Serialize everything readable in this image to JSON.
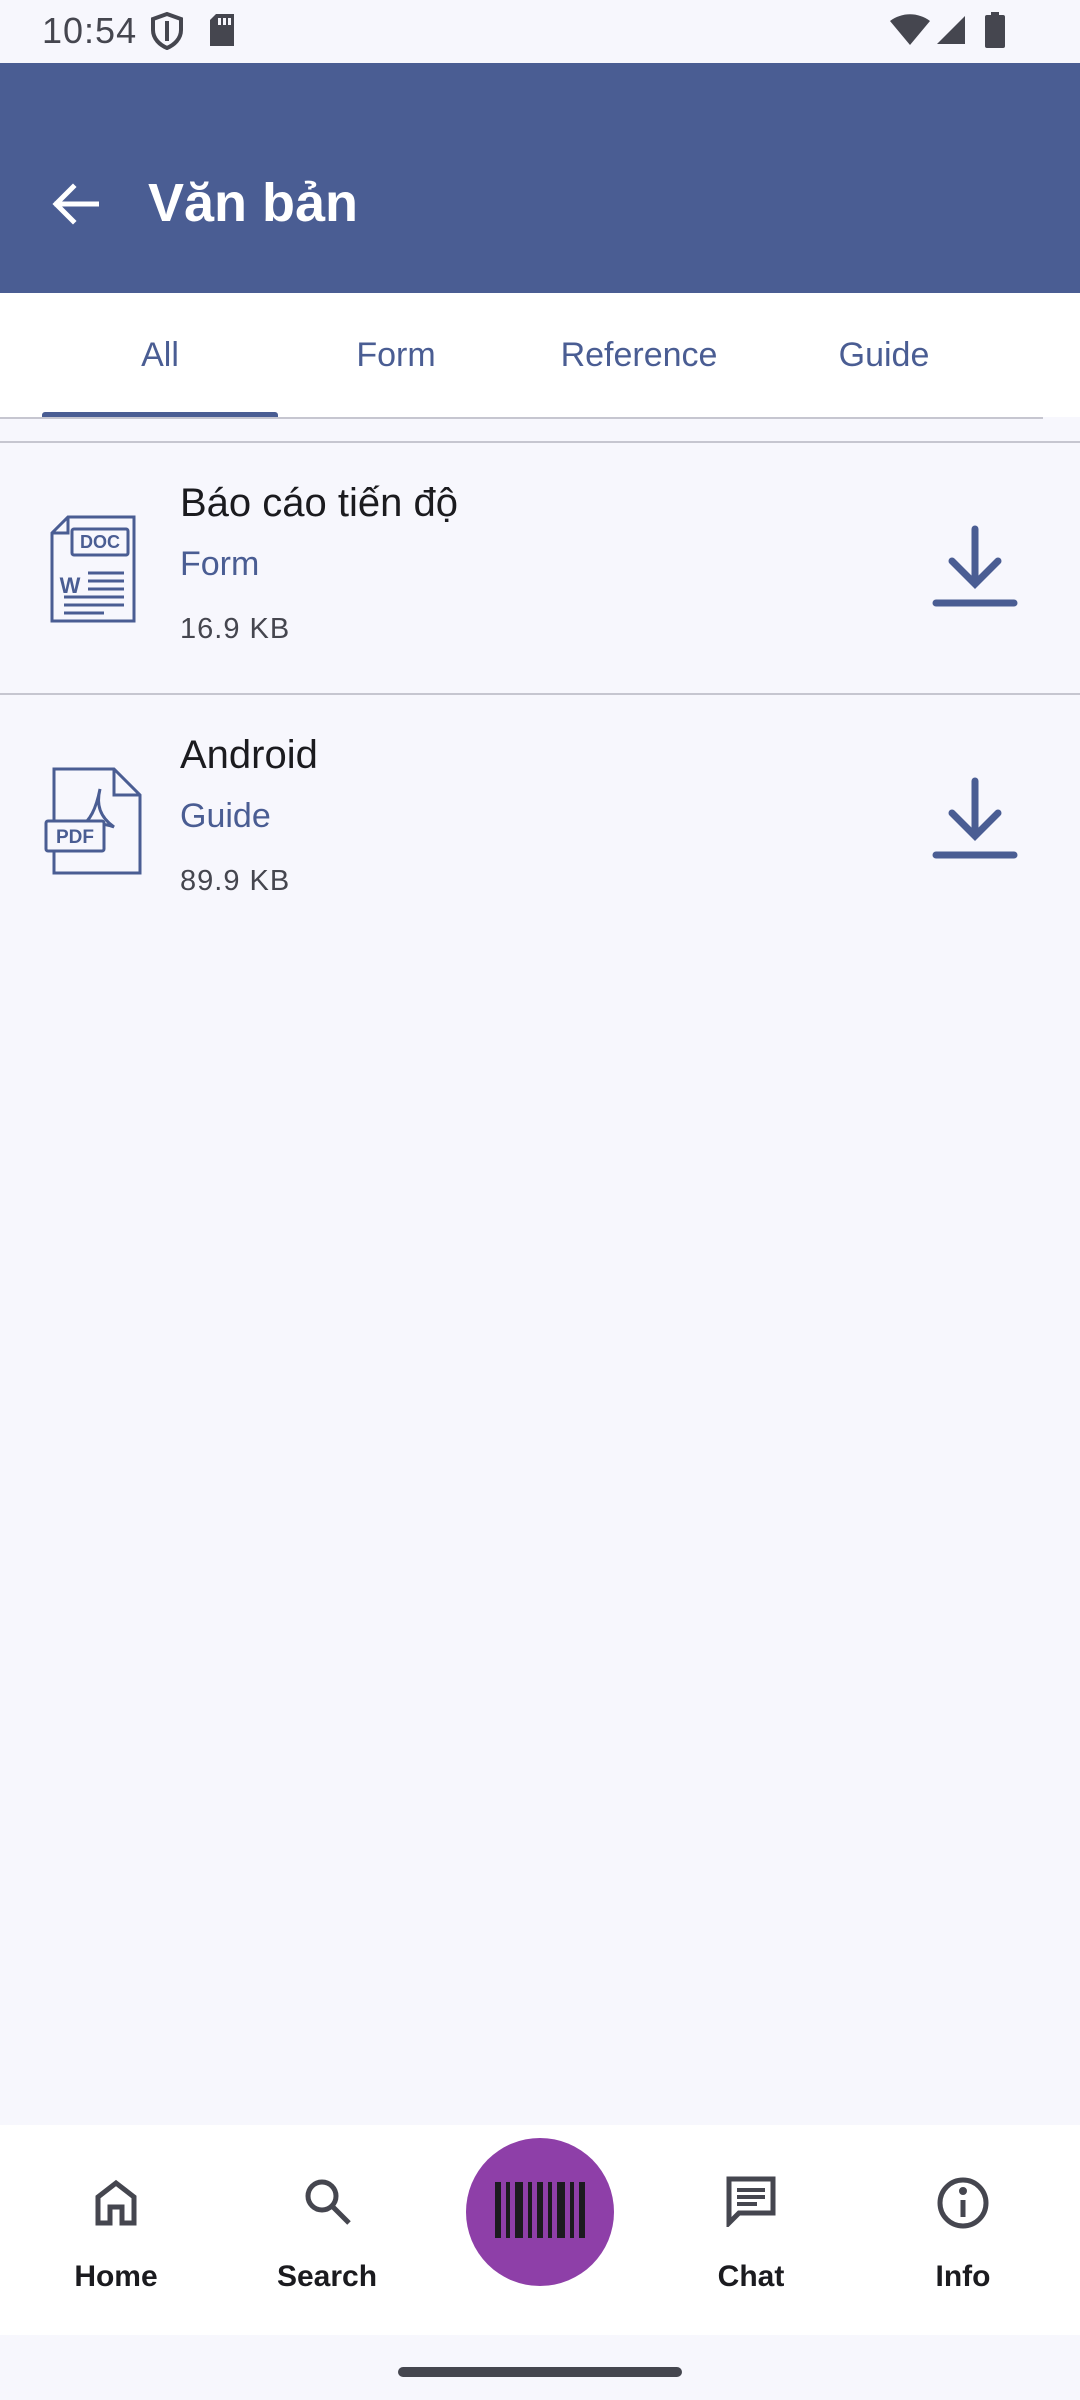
{
  "status_bar": {
    "time": "10:54",
    "left_icons": [
      "shield-icon",
      "sd-card-icon"
    ],
    "right_icons": [
      "wifi-icon",
      "cellular-signal-icon",
      "battery-icon"
    ]
  },
  "app_bar": {
    "title": "Văn bản",
    "back_icon": "arrow-back-icon",
    "color": "#4a5d93"
  },
  "tabs": [
    {
      "label": "All",
      "selected": true
    },
    {
      "label": "Form",
      "selected": false
    },
    {
      "label": "Reference",
      "selected": false
    },
    {
      "label": "Guide",
      "selected": false
    }
  ],
  "documents": [
    {
      "title": "Báo cáo tiến độ",
      "category": "Form",
      "size": "16.9 KB",
      "file_type": "DOC",
      "icon": "doc-file-icon",
      "action_icon": "download-icon"
    },
    {
      "title": "Android",
      "category": "Guide",
      "size": "89.9 KB",
      "file_type": "PDF",
      "icon": "pdf-file-icon",
      "action_icon": "download-icon"
    }
  ],
  "bottom_nav": {
    "items": [
      {
        "label": "Home",
        "icon": "home-icon"
      },
      {
        "label": "Search",
        "icon": "search-icon"
      },
      {
        "label": "Chat",
        "icon": "chat-icon"
      },
      {
        "label": "Info",
        "icon": "info-icon"
      }
    ],
    "center_action": {
      "icon": "barcode-scan-icon",
      "color": "#8e3fa8"
    }
  },
  "colors": {
    "primary": "#4a5d93",
    "background": "#f7f7fd",
    "accent": "#8e3fa8"
  }
}
